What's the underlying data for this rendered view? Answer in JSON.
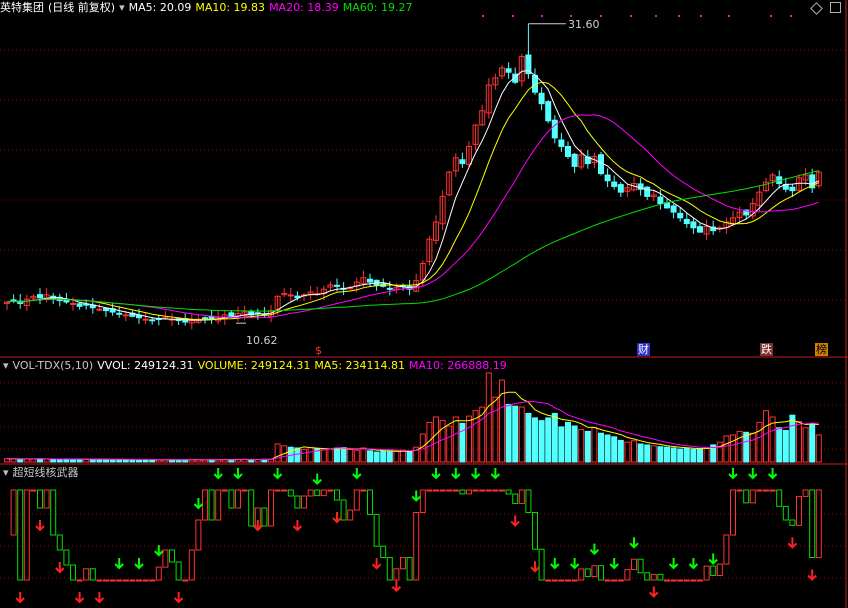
{
  "header": {
    "stock_name": "英特集团",
    "period": "(日线 前复权)",
    "ma5": "MA5: 20.09",
    "ma10": "MA10: 19.83",
    "ma20": "MA20: 18.39",
    "ma60": "MA60: 19.27"
  },
  "volume_header": {
    "indicator": "VOL-TDX(5,10)",
    "vvol": "VVOL: 249124.31",
    "volume": "VOLUME: 249124.31",
    "ma5": "MA5: 234114.81",
    "ma10": "MA10: 266888.19"
  },
  "indicator_header": {
    "name": "超短线核武器"
  },
  "markers": {
    "high_label": "31.60",
    "low_label": "10.62",
    "fin_tag": "财",
    "event_tag1": "$",
    "event_tag2": "跌",
    "event_tag3": "榜"
  },
  "colors": {
    "background": "#000000",
    "up": "#ff3232",
    "down": "#54ffff",
    "ma5": "#ffffff",
    "ma10": "#ffff00",
    "ma20": "#ff00ff",
    "ma60": "#00e000",
    "grid": "#8b0000"
  },
  "chart_data": {
    "type": "candlestick",
    "series_count": 124,
    "price_range": [
      10.0,
      32.0
    ],
    "high": 31.6,
    "low": 10.62,
    "close": [
      12.1,
      12.2,
      12.0,
      12.3,
      12.5,
      12.4,
      12.6,
      12.3,
      12.2,
      12.1,
      12.0,
      11.8,
      11.9,
      11.7,
      11.6,
      11.5,
      11.4,
      11.3,
      11.2,
      11.1,
      11.0,
      10.9,
      10.8,
      10.9,
      11.0,
      10.9,
      10.8,
      10.7,
      10.8,
      10.9,
      11.0,
      10.9,
      11.0,
      11.2,
      11.1,
      11.3,
      11.4,
      11.2,
      11.3,
      11.2,
      11.5,
      12.5,
      12.7,
      12.6,
      12.4,
      12.6,
      12.8,
      12.7,
      13.0,
      13.3,
      13.2,
      13.0,
      13.1,
      13.5,
      13.8,
      13.5,
      13.3,
      13.2,
      13.0,
      13.1,
      13.2,
      13.0,
      13.6,
      14.8,
      16.5,
      17.7,
      19.5,
      21.2,
      22.2,
      21.8,
      23.0,
      24.5,
      25.5,
      27.3,
      27.8,
      28.5,
      28.2,
      27.5,
      29.3,
      28.1,
      26.8,
      26.0,
      24.8,
      23.6,
      23.0,
      22.3,
      21.6,
      22.4,
      21.8,
      22.3,
      21.1,
      20.6,
      20.2,
      19.8,
      20.1,
      20.4,
      20.0,
      19.5,
      19.6,
      19.0,
      18.7,
      18.4,
      18.0,
      17.6,
      17.3,
      17.0,
      17.4,
      17.1,
      17.3,
      17.7,
      18.0,
      18.4,
      18.2,
      19.0,
      19.8,
      20.5,
      21.0,
      20.4,
      20.0,
      19.9,
      20.8,
      21.0,
      20.1,
      21.2
    ],
    "volume_range": [
      0,
      500000
    ],
    "volume": [
      18000,
      19000,
      15000,
      17000,
      16000,
      18000,
      17500,
      16000,
      15500,
      17000,
      16000,
      15000,
      14000,
      15500,
      15000,
      14500,
      14000,
      13500,
      13000,
      13500,
      12500,
      13000,
      12000,
      12500,
      13000,
      12500,
      12000,
      11500,
      12500,
      13000,
      12000,
      12500,
      13000,
      14000,
      13500,
      14500,
      15000,
      14000,
      13500,
      14500,
      15500,
      100000,
      90000,
      82000,
      78000,
      70000,
      80000,
      75000,
      68000,
      72000,
      78000,
      80000,
      70000,
      65000,
      78000,
      62000,
      55000,
      60000,
      58000,
      60000,
      65000,
      60000,
      82000,
      155000,
      220000,
      250000,
      230000,
      200000,
      250000,
      215000,
      255000,
      285000,
      305000,
      495000,
      360000,
      455000,
      320000,
      310000,
      305000,
      270000,
      245000,
      230000,
      245000,
      270000,
      195000,
      220000,
      200000,
      180000,
      170000,
      190000,
      160000,
      150000,
      140000,
      120000,
      110000,
      118000,
      100000,
      95000,
      90000,
      85000,
      82000,
      78000,
      72000,
      78000,
      70000,
      74000,
      80000,
      95000,
      110000,
      145000,
      150000,
      170000,
      165000,
      160000,
      220000,
      285000,
      250000,
      190000,
      175000,
      260000,
      225000,
      190000,
      210000,
      150000
    ],
    "indicator_range": [
      0,
      100
    ]
  }
}
